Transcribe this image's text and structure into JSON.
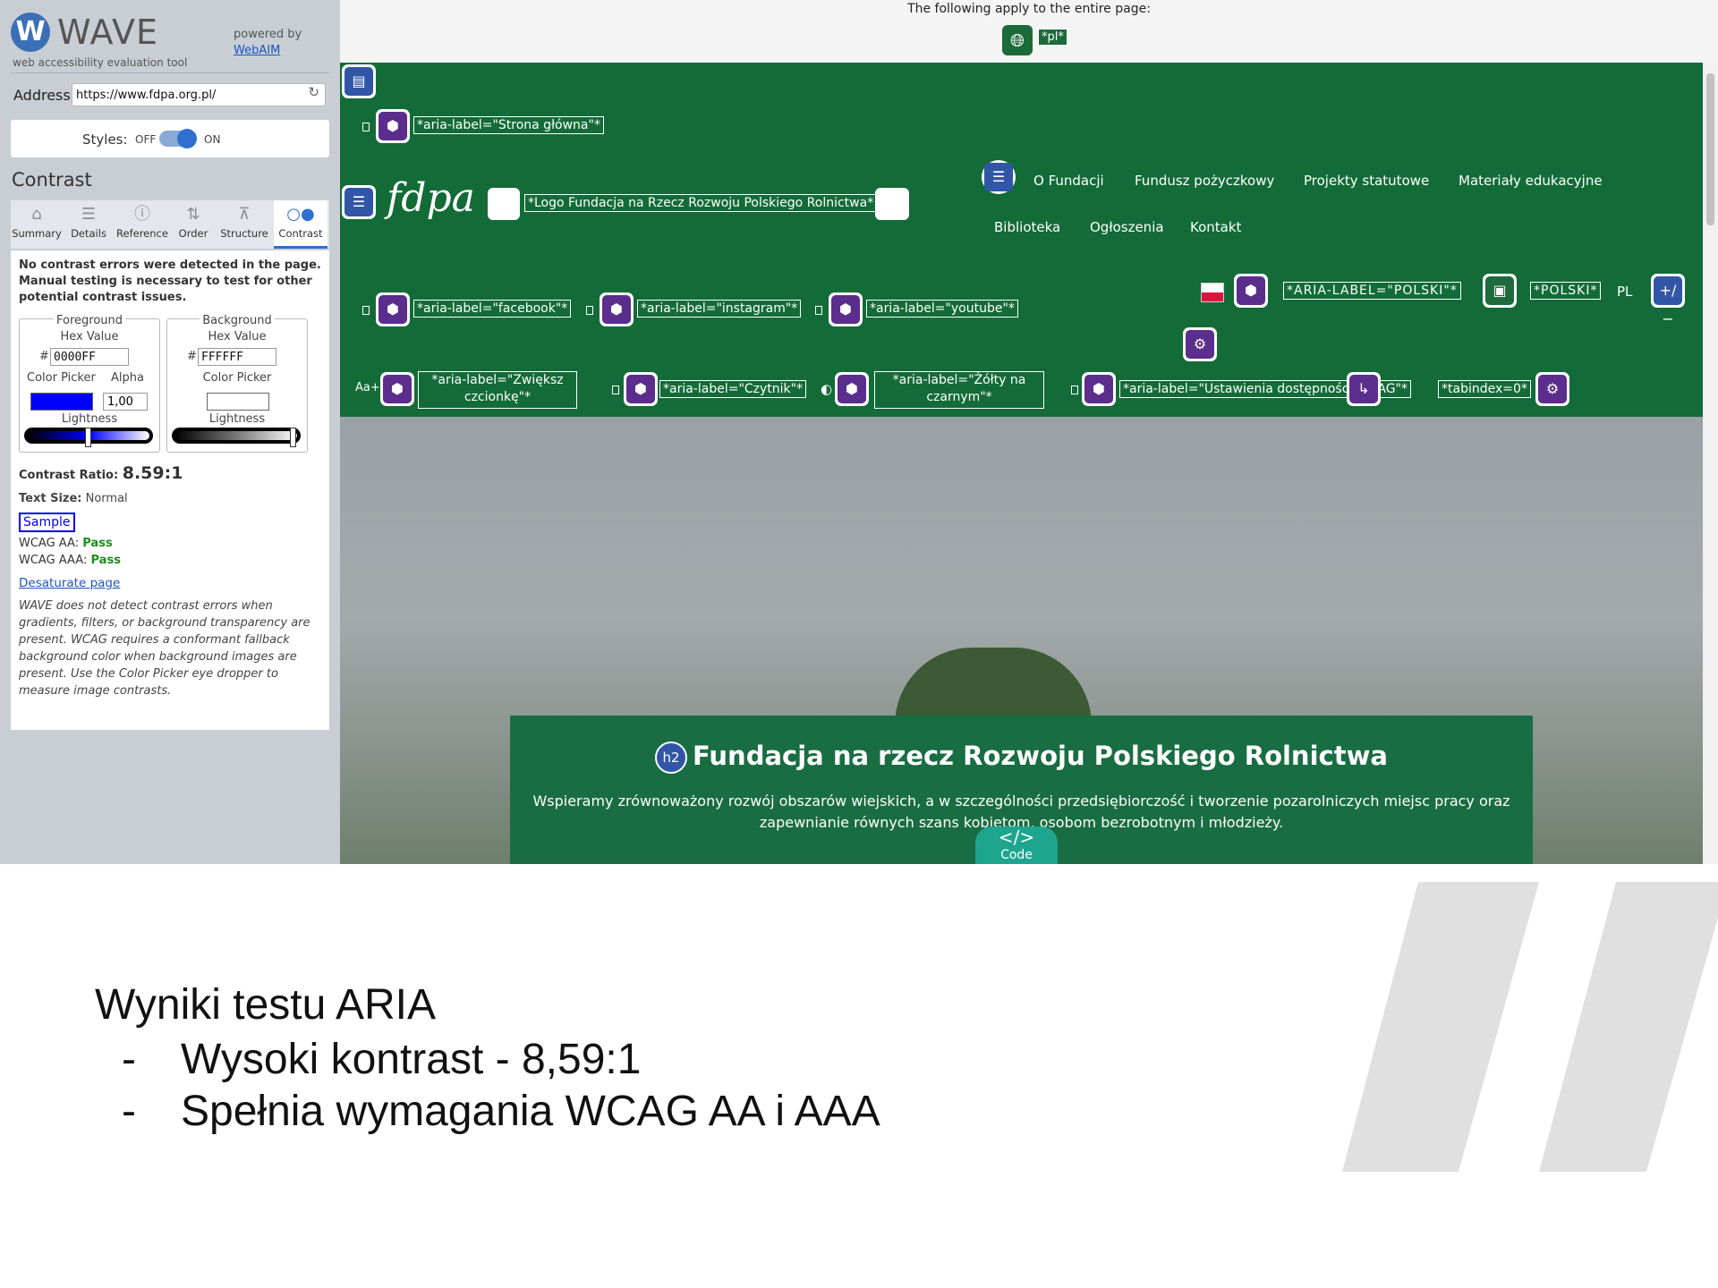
{
  "wave": {
    "logo_letter": "W",
    "logo_name": "WAVE",
    "logo_tagline": "web accessibility evaluation tool",
    "powered_by": "powered by",
    "powered_link": "WebAIM",
    "address_label": "Address:",
    "address_value": "https://www.fdpa.org.pl/",
    "styles_label": "Styles:",
    "styles_off": "OFF",
    "styles_on": "ON",
    "styles_enabled": true,
    "section_title": "Contrast",
    "tabs": [
      {
        "label": "Summary",
        "icon": "home-icon"
      },
      {
        "label": "Details",
        "icon": "list-icon"
      },
      {
        "label": "Reference",
        "icon": "info-icon"
      },
      {
        "label": "Order",
        "icon": "order-icon"
      },
      {
        "label": "Structure",
        "icon": "structure-icon"
      },
      {
        "label": "Contrast",
        "icon": "contrast-icon",
        "active": true
      }
    ],
    "no_errors_note": "No contrast errors were detected in the page. Manual testing is necessary to test for other potential contrast issues.",
    "foreground": {
      "legend": "Foreground",
      "hex_label": "Hex Value",
      "hex": "0000FF",
      "picker_label": "Color Picker",
      "alpha_label": "Alpha",
      "alpha": "1,00",
      "lightness_label": "Lightness",
      "color": "#0000FF",
      "lightness_level": 0.5
    },
    "background": {
      "legend": "Background",
      "hex_label": "Hex Value",
      "hex": "FFFFFF",
      "picker_label": "Color Picker",
      "lightness_label": "Lightness",
      "color": "#FFFFFF",
      "lightness_level": 1.0
    },
    "hash": "#",
    "ratio_label": "Contrast Ratio:",
    "ratio_value": "8.59:1",
    "size_label": "Text Size:",
    "size_value": "Normal",
    "sample": "Sample",
    "wcag_aa_label": "WCAG AA:",
    "wcag_aa": "Pass",
    "wcag_aaa_label": "WCAG AAA:",
    "wcag_aaa": "Pass",
    "desaturate": "Desaturate page",
    "disclaimer": "WAVE does not detect contrast errors when gradients, filters, or background transparency are present. WCAG requires a conformant fallback background color when background images are present. Use the Color Picker eye dropper to measure image contrasts."
  },
  "page": {
    "applies_text": "The following apply to the entire page:",
    "lang_badge": "*pl*",
    "home_label": "*aria-label=\"Strona główna\"*",
    "logo_text": "fdpa",
    "logo_label": "*Logo Fundacja na Rzecz Rozwoju Polskiego Rolnictwa*",
    "nav_row1": [
      "O Fundacji",
      "Fundusz pożyczkowy",
      "Projekty statutowe",
      "Materiały edukacyjne"
    ],
    "nav_row2": [
      "Biblioteka",
      "Ogłoszenia",
      "Kontakt"
    ],
    "social": [
      "*aria-label=\"facebook\"*",
      "*aria-label=\"instagram\"*",
      "*aria-label=\"youtube\"*"
    ],
    "lang_label": "*ARIA-LABEL=\"POLSKI\"*",
    "lang_polski": "*POLSKI*",
    "lang_code": "PL",
    "lang_toggle": "+/−",
    "font_toggle": "Aa+",
    "font_label": "*aria-label=\"Zwiększ czcionkę\"*",
    "reader_label": "*aria-label=\"Czytnik\"*",
    "contrast_label": "*aria-label=\"Żółty na czarnym\"*",
    "wcag_label": "*aria-label=\"Ustawienia dostępności WCAG\"*",
    "tabindex_label": "*tabindex=0*",
    "hero_h2": "h2",
    "hero_title": "Fundacja na rzecz Rozwoju Polskiego Rolnictwa",
    "hero_text": "Wspieramy zrównoważony rozwój obszarów wiejskich, a w szczególności przedsiębiorczość i tworzenie pozarolniczych miejsc pracy oraz zapewnianie równych szans kobietom, osobom bezrobotnym i młodzieży.",
    "code_glyph": "</>",
    "code_label": "Code"
  },
  "slide": {
    "heading": "Wyniki testu ARIA",
    "bullets": [
      "Wysoki kontrast - 8,59:1",
      "Spełnia wymagania WCAG AA i AAA"
    ],
    "bullet_mark": "-"
  },
  "colors": {
    "site_green": "#136B38",
    "wave_purple": "#5B2D8C",
    "wave_blue": "#3156A8",
    "pass_green": "#1C8D1C"
  }
}
